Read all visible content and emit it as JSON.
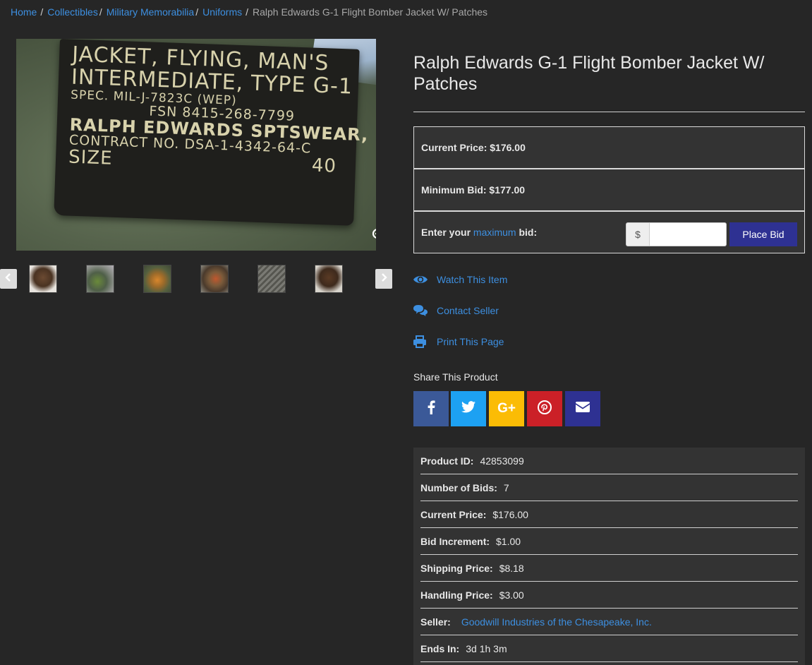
{
  "breadcrumb": {
    "items": [
      "Home",
      "Collectibles",
      "Military Memorabilia",
      "Uniforms"
    ],
    "current": "Ralph Edwards G-1 Flight Bomber Jacket W/ Patches"
  },
  "image": {
    "label_lines": [
      "JACKET, FLYING, MAN'S",
      "INTERMEDIATE, TYPE G-1",
      "SPEC. MIL-J-7823C (WEP)",
      "FSN 8415-268-7799",
      "RALPH EDWARDS SPTSWEAR, INC.",
      "CONTRACT NO. DSA-1-4342-64-C"
    ],
    "size_label": "SIZE",
    "size_value": "40"
  },
  "product": {
    "title": "Ralph Edwards G-1 Flight Bomber Jacket W/ Patches",
    "current_price_text": "Current Price: $176.00",
    "minimum_bid_text": "Minimum Bid: $177.00",
    "bid_prompt_pre": "Enter your ",
    "bid_prompt_link": "maximum",
    "bid_prompt_post": " bid:",
    "currency_symbol": "$",
    "bid_value": "",
    "place_bid_label": "Place Bid"
  },
  "actions": {
    "watch": "Watch This Item",
    "contact": "Contact Seller",
    "print": "Print This Page"
  },
  "share": {
    "title": "Share This Product",
    "networks": [
      "facebook",
      "twitter",
      "google-plus",
      "pinterest",
      "email"
    ],
    "colors": {
      "facebook": "#3b5998",
      "twitter": "#1da1f2",
      "google-plus": "#fbbc05",
      "pinterest": "#cb2027",
      "email": "#2e3192"
    }
  },
  "details": {
    "product_id_label": "Product ID:",
    "product_id": "42853099",
    "bids_label": "Number of Bids:",
    "bids": "7",
    "current_price_label": "Current Price:",
    "current_price": "$176.00",
    "increment_label": "Bid Increment:",
    "increment": "$1.00",
    "shipping_label": "Shipping Price:",
    "shipping": "$8.18",
    "handling_label": "Handling Price:",
    "handling": "$3.00",
    "seller_label": "Seller:",
    "seller": "Goodwill Industries of the Chesapeake, Inc.",
    "ends_label": "Ends In:",
    "ends": "3d 1h 3m"
  },
  "colors": {
    "background": "#262626",
    "link": "#3d8fe0",
    "primary_button": "#2e3192",
    "panel": "#333333"
  }
}
